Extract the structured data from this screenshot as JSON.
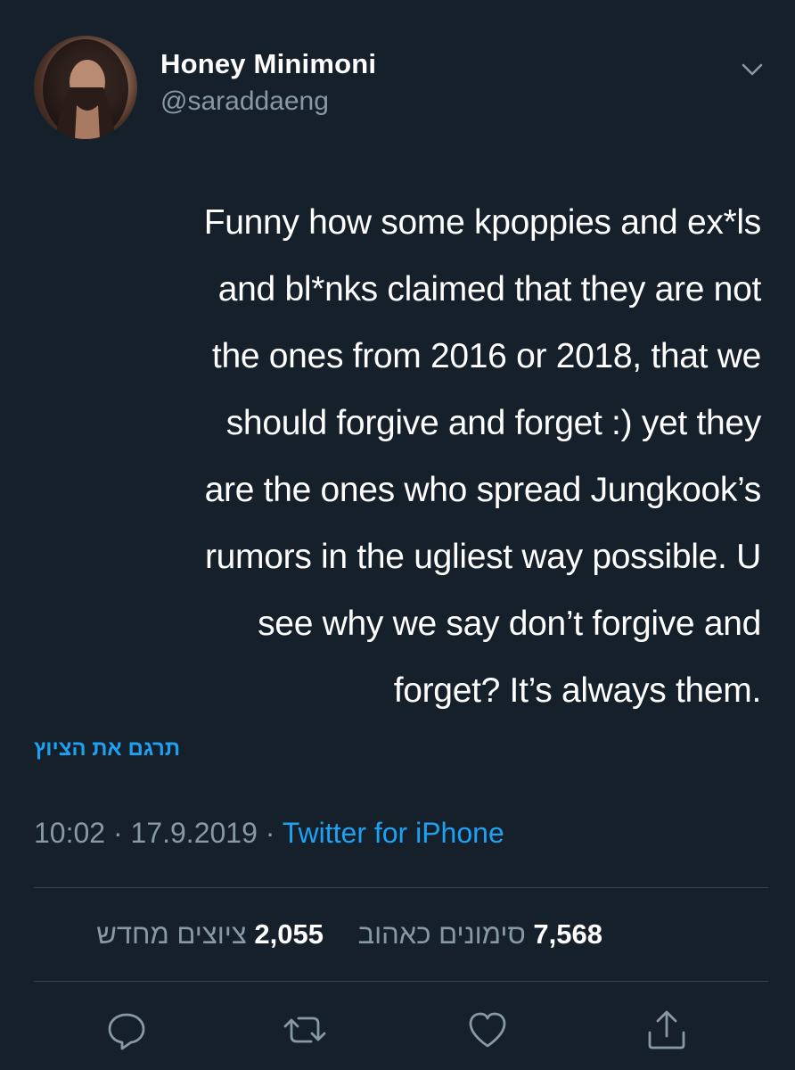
{
  "tweet": {
    "author": {
      "display_name": "Honey Minimoni",
      "handle": "@saraddaeng"
    },
    "text_lines": [
      "Funny how some kpoppies and ex*ls",
      "and bl*nks claimed that they are not",
      "the ones from 2016 or 2018, that we",
      "should forgive and forget :) yet they",
      "are the ones who spread Jungkook’s",
      "rumors in the ugliest way possible. U",
      "see why we say don’t forgive and",
      "forget? It’s always them."
    ],
    "translate_label": "תרגם את הציוץ",
    "time": "10:02",
    "date": "17.9.2019",
    "separator": "·",
    "source": "Twitter for iPhone"
  },
  "stats": {
    "likes_count": "7,568",
    "likes_label": "סימונים כאהוב",
    "retweets_count": "2,055",
    "retweets_label": "ציוצים מחדש"
  },
  "icons": {
    "caret": "chevron-down-icon",
    "reply": "reply-icon",
    "retweet": "retweet-icon",
    "like": "heart-icon",
    "share": "share-icon"
  },
  "colors": {
    "background": "#15202b",
    "text_primary": "#ffffff",
    "text_secondary": "#8899a6",
    "accent": "#1da1f2",
    "divider": "#38444d"
  }
}
